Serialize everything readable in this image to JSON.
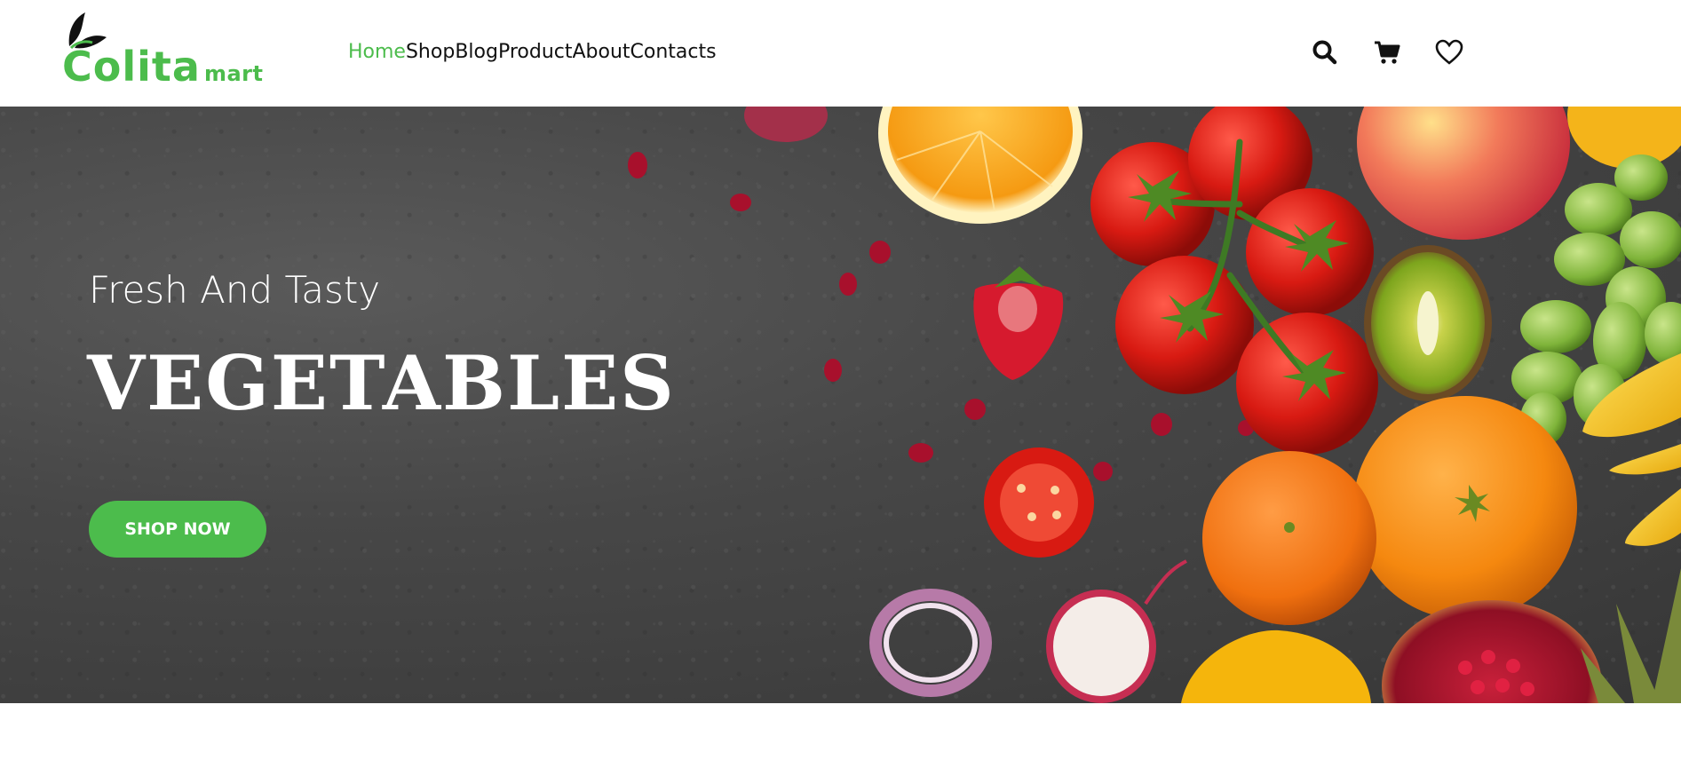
{
  "brand": {
    "logo_main": "Colita",
    "logo_sub": "mart",
    "color": "#4cbc4c"
  },
  "nav": {
    "items": [
      {
        "label": "Home",
        "active": true
      },
      {
        "label": "Shop",
        "active": false
      },
      {
        "label": "Blog",
        "active": false
      },
      {
        "label": "Product",
        "active": false
      },
      {
        "label": "About",
        "active": false
      },
      {
        "label": "Contacts",
        "active": false
      }
    ],
    "active_color": "#4cbc4c"
  },
  "header_icons": [
    "search-icon",
    "cart-icon",
    "heart-icon"
  ],
  "hero": {
    "subtitle": "Fresh And Tasty",
    "title": "VEGETABLES",
    "cta_label": "SHOP NOW",
    "background_color": "#424242"
  }
}
